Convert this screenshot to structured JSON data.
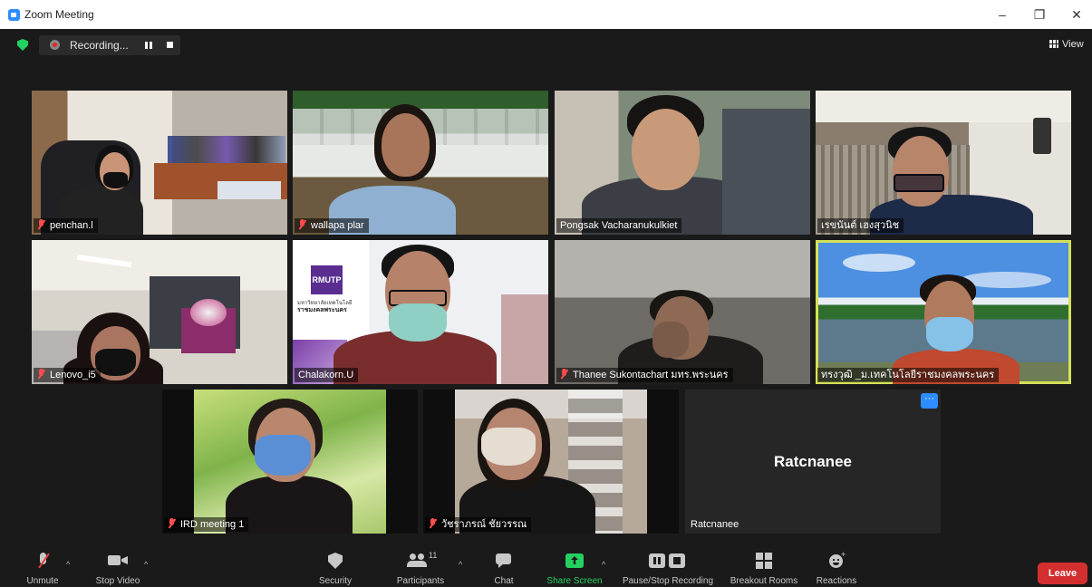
{
  "window": {
    "title": "Zoom Meeting",
    "minimize": "–",
    "restore": "❐",
    "close": "✕"
  },
  "top_bar": {
    "recording_label": "Recording...",
    "view_label": "View"
  },
  "participants": [
    {
      "name": "penchan.l",
      "muted": true
    },
    {
      "name": "wallapa plar",
      "muted": true
    },
    {
      "name": "Pongsak Vacharanukulkiet",
      "muted": false
    },
    {
      "name": "เรขนันต์ เฮงสุวนิช",
      "muted": false
    },
    {
      "name": "Lenovo_i5",
      "muted": true
    },
    {
      "name": "Chalakorn.U",
      "muted": false
    },
    {
      "name": "Thanee Sukontachart มทร.พระนคร",
      "muted": true
    },
    {
      "name": "ทรงวุฒิ _ม.เทคโนโลยีราชมงคลพระนคร",
      "muted": false,
      "active_speaker": true
    },
    {
      "name": "IRD meeting 1",
      "muted": true
    },
    {
      "name": "วัชราภรณ์ ชัยวรรณ",
      "muted": true
    },
    {
      "name": "Ratcnanee",
      "muted": false,
      "video_off": true,
      "display_text": "Ratcnanee"
    }
  ],
  "tile_texts": {
    "rmutp_logo": "RMUTP",
    "rmutp_line1": "มหาวิทยาลัยเทคโนโลยี",
    "rmutp_line2": "ราชมงคลพระนคร",
    "more_button": "···"
  },
  "toolbar": {
    "unmute": "Unmute",
    "stop_video": "Stop Video",
    "security": "Security",
    "participants": "Participants",
    "participants_count": "11",
    "chat": "Chat",
    "share_screen": "Share Screen",
    "pause_stop_recording": "Pause/Stop Recording",
    "breakout_rooms": "Breakout Rooms",
    "reactions": "Reactions",
    "leave": "Leave",
    "caret": "^"
  },
  "colors": {
    "accent": "#2d8cff",
    "share_green": "#23d160",
    "leave_red": "#d32f2f",
    "active_border": "#d4e157"
  }
}
